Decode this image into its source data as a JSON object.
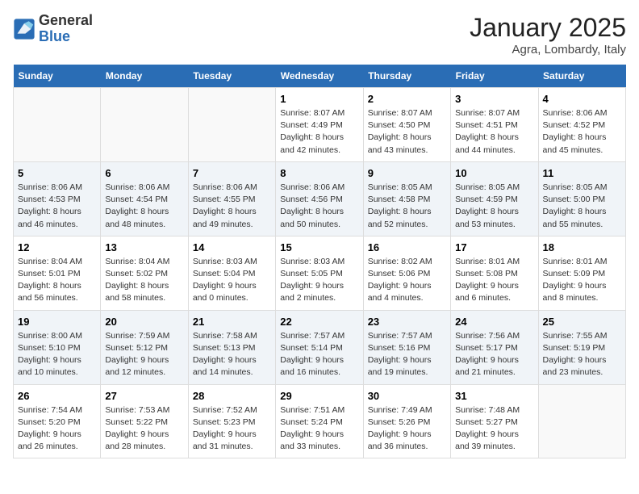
{
  "header": {
    "logo_general": "General",
    "logo_blue": "Blue",
    "title": "January 2025",
    "subtitle": "Agra, Lombardy, Italy"
  },
  "weekdays": [
    "Sunday",
    "Monday",
    "Tuesday",
    "Wednesday",
    "Thursday",
    "Friday",
    "Saturday"
  ],
  "weeks": [
    [
      {
        "day": "",
        "info": ""
      },
      {
        "day": "",
        "info": ""
      },
      {
        "day": "",
        "info": ""
      },
      {
        "day": "1",
        "info": "Sunrise: 8:07 AM\nSunset: 4:49 PM\nDaylight: 8 hours and 42 minutes."
      },
      {
        "day": "2",
        "info": "Sunrise: 8:07 AM\nSunset: 4:50 PM\nDaylight: 8 hours and 43 minutes."
      },
      {
        "day": "3",
        "info": "Sunrise: 8:07 AM\nSunset: 4:51 PM\nDaylight: 8 hours and 44 minutes."
      },
      {
        "day": "4",
        "info": "Sunrise: 8:06 AM\nSunset: 4:52 PM\nDaylight: 8 hours and 45 minutes."
      }
    ],
    [
      {
        "day": "5",
        "info": "Sunrise: 8:06 AM\nSunset: 4:53 PM\nDaylight: 8 hours and 46 minutes."
      },
      {
        "day": "6",
        "info": "Sunrise: 8:06 AM\nSunset: 4:54 PM\nDaylight: 8 hours and 48 minutes."
      },
      {
        "day": "7",
        "info": "Sunrise: 8:06 AM\nSunset: 4:55 PM\nDaylight: 8 hours and 49 minutes."
      },
      {
        "day": "8",
        "info": "Sunrise: 8:06 AM\nSunset: 4:56 PM\nDaylight: 8 hours and 50 minutes."
      },
      {
        "day": "9",
        "info": "Sunrise: 8:05 AM\nSunset: 4:58 PM\nDaylight: 8 hours and 52 minutes."
      },
      {
        "day": "10",
        "info": "Sunrise: 8:05 AM\nSunset: 4:59 PM\nDaylight: 8 hours and 53 minutes."
      },
      {
        "day": "11",
        "info": "Sunrise: 8:05 AM\nSunset: 5:00 PM\nDaylight: 8 hours and 55 minutes."
      }
    ],
    [
      {
        "day": "12",
        "info": "Sunrise: 8:04 AM\nSunset: 5:01 PM\nDaylight: 8 hours and 56 minutes."
      },
      {
        "day": "13",
        "info": "Sunrise: 8:04 AM\nSunset: 5:02 PM\nDaylight: 8 hours and 58 minutes."
      },
      {
        "day": "14",
        "info": "Sunrise: 8:03 AM\nSunset: 5:04 PM\nDaylight: 9 hours and 0 minutes."
      },
      {
        "day": "15",
        "info": "Sunrise: 8:03 AM\nSunset: 5:05 PM\nDaylight: 9 hours and 2 minutes."
      },
      {
        "day": "16",
        "info": "Sunrise: 8:02 AM\nSunset: 5:06 PM\nDaylight: 9 hours and 4 minutes."
      },
      {
        "day": "17",
        "info": "Sunrise: 8:01 AM\nSunset: 5:08 PM\nDaylight: 9 hours and 6 minutes."
      },
      {
        "day": "18",
        "info": "Sunrise: 8:01 AM\nSunset: 5:09 PM\nDaylight: 9 hours and 8 minutes."
      }
    ],
    [
      {
        "day": "19",
        "info": "Sunrise: 8:00 AM\nSunset: 5:10 PM\nDaylight: 9 hours and 10 minutes."
      },
      {
        "day": "20",
        "info": "Sunrise: 7:59 AM\nSunset: 5:12 PM\nDaylight: 9 hours and 12 minutes."
      },
      {
        "day": "21",
        "info": "Sunrise: 7:58 AM\nSunset: 5:13 PM\nDaylight: 9 hours and 14 minutes."
      },
      {
        "day": "22",
        "info": "Sunrise: 7:57 AM\nSunset: 5:14 PM\nDaylight: 9 hours and 16 minutes."
      },
      {
        "day": "23",
        "info": "Sunrise: 7:57 AM\nSunset: 5:16 PM\nDaylight: 9 hours and 19 minutes."
      },
      {
        "day": "24",
        "info": "Sunrise: 7:56 AM\nSunset: 5:17 PM\nDaylight: 9 hours and 21 minutes."
      },
      {
        "day": "25",
        "info": "Sunrise: 7:55 AM\nSunset: 5:19 PM\nDaylight: 9 hours and 23 minutes."
      }
    ],
    [
      {
        "day": "26",
        "info": "Sunrise: 7:54 AM\nSunset: 5:20 PM\nDaylight: 9 hours and 26 minutes."
      },
      {
        "day": "27",
        "info": "Sunrise: 7:53 AM\nSunset: 5:22 PM\nDaylight: 9 hours and 28 minutes."
      },
      {
        "day": "28",
        "info": "Sunrise: 7:52 AM\nSunset: 5:23 PM\nDaylight: 9 hours and 31 minutes."
      },
      {
        "day": "29",
        "info": "Sunrise: 7:51 AM\nSunset: 5:24 PM\nDaylight: 9 hours and 33 minutes."
      },
      {
        "day": "30",
        "info": "Sunrise: 7:49 AM\nSunset: 5:26 PM\nDaylight: 9 hours and 36 minutes."
      },
      {
        "day": "31",
        "info": "Sunrise: 7:48 AM\nSunset: 5:27 PM\nDaylight: 9 hours and 39 minutes."
      },
      {
        "day": "",
        "info": ""
      }
    ]
  ]
}
